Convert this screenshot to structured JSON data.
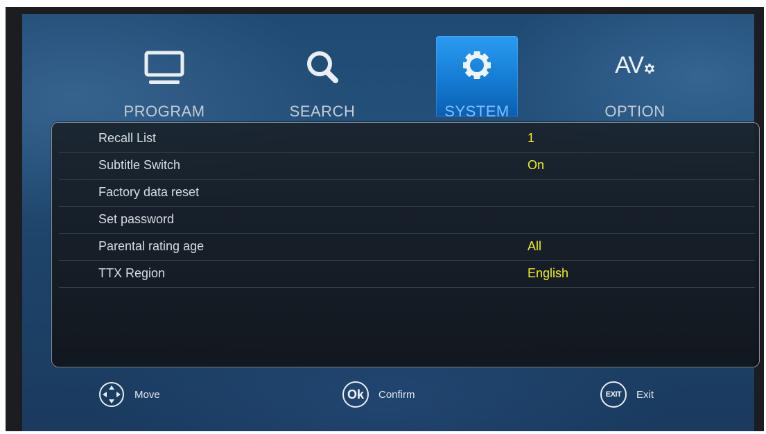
{
  "tabs": [
    {
      "label": "PROGRAM",
      "icon": "tv-icon",
      "active": false
    },
    {
      "label": "SEARCH",
      "icon": "search-icon",
      "active": false
    },
    {
      "label": "SYSTEM",
      "icon": "gear-icon",
      "active": true
    },
    {
      "label": "OPTION",
      "icon": "av-settings-icon",
      "icon_text": "AV",
      "active": false
    }
  ],
  "menu": {
    "items": [
      {
        "label": "Recall List",
        "value": "1"
      },
      {
        "label": "Subtitle Switch",
        "value": "On"
      },
      {
        "label": "Factory data reset",
        "value": ""
      },
      {
        "label": "Set password",
        "value": ""
      },
      {
        "label": "Parental rating age",
        "value": "All"
      },
      {
        "label": "TTX Region",
        "value": "English"
      }
    ]
  },
  "footer": {
    "move": {
      "label": "Move",
      "icon": "dpad-icon"
    },
    "confirm": {
      "label": "Confirm",
      "icon": "ok-icon",
      "icon_text": "Ok"
    },
    "exit": {
      "label": "Exit",
      "icon": "exit-icon",
      "icon_text": "EXIT"
    }
  },
  "colors": {
    "accent": "#1a86e0",
    "value_text": "#f0ef22",
    "label_text": "#d7dde3"
  }
}
